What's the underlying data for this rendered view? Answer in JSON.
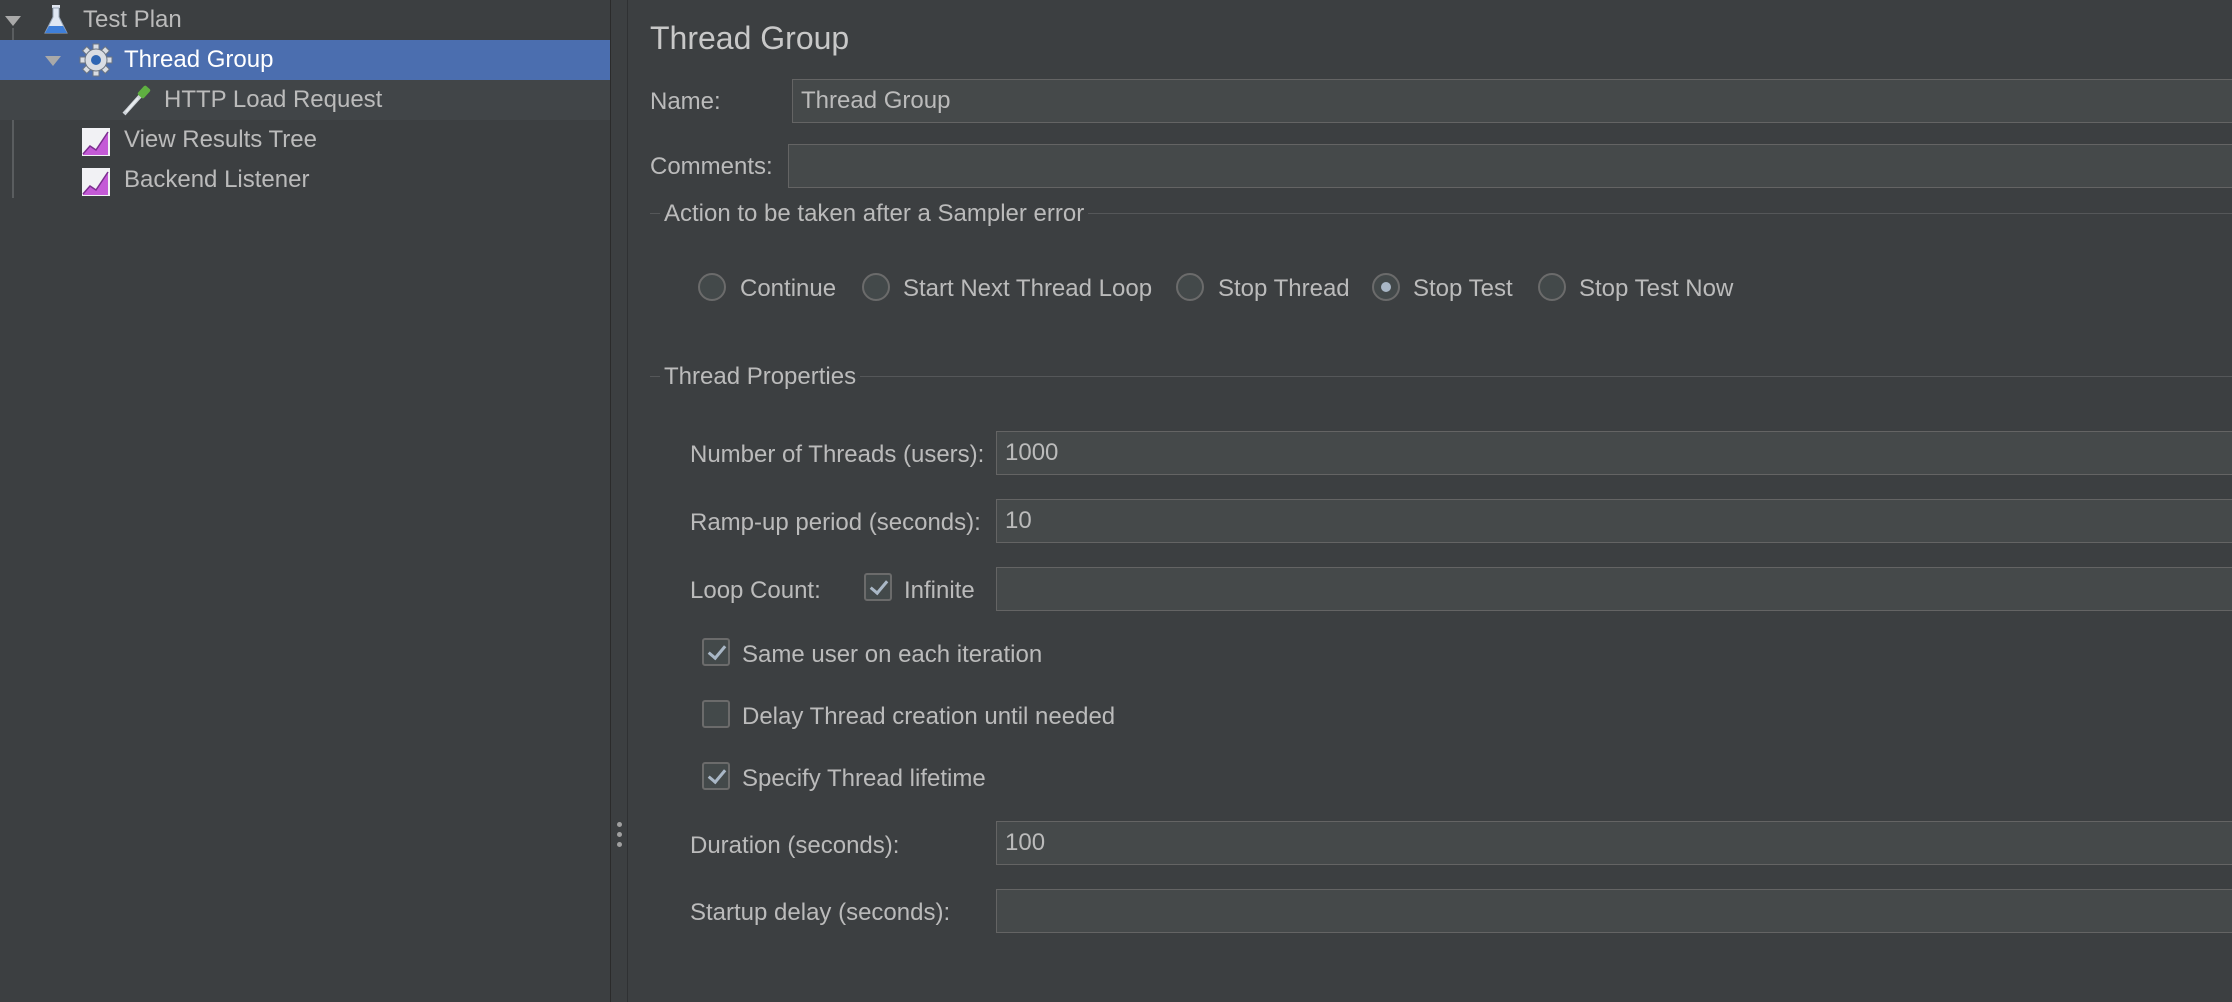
{
  "tree": {
    "items": [
      {
        "label": "Test Plan",
        "icon": "flask-icon"
      },
      {
        "label": "Thread Group",
        "icon": "gear-icon",
        "selected": true
      },
      {
        "label": "HTTP Load Request",
        "icon": "pipette-icon"
      },
      {
        "label": "View Results Tree",
        "icon": "chart-icon"
      },
      {
        "label": "Backend Listener",
        "icon": "chart-icon"
      }
    ]
  },
  "panel": {
    "title": "Thread Group",
    "name_label": "Name:",
    "name_value": "Thread Group",
    "comments_label": "Comments:",
    "comments_value": "",
    "sampler_error": {
      "title": "Action to be taken after a Sampler error",
      "options": [
        {
          "label": "Continue",
          "selected": false
        },
        {
          "label": "Start Next Thread Loop",
          "selected": false
        },
        {
          "label": "Stop Thread",
          "selected": false
        },
        {
          "label": "Stop Test",
          "selected": true
        },
        {
          "label": "Stop Test Now",
          "selected": false
        }
      ]
    },
    "thread_properties": {
      "title": "Thread Properties",
      "threads_label": "Number of Threads (users):",
      "threads_value": "1000",
      "rampup_label": "Ramp-up period (seconds):",
      "rampup_value": "10",
      "loop_label": "Loop Count:",
      "infinite_label": "Infinite",
      "infinite_checked": true,
      "loop_value": "",
      "same_user_label": "Same user on each iteration",
      "same_user_checked": true,
      "delay_label": "Delay Thread creation until needed",
      "delay_checked": false,
      "lifetime_label": "Specify Thread lifetime",
      "lifetime_checked": true,
      "duration_label": "Duration (seconds):",
      "duration_value": "100",
      "startup_label": "Startup delay (seconds):",
      "startup_value": ""
    }
  },
  "colors": {
    "background": "#3c3f41",
    "selection": "#4b6eaf",
    "field": "#45494a",
    "text": "#bbbbbb"
  }
}
